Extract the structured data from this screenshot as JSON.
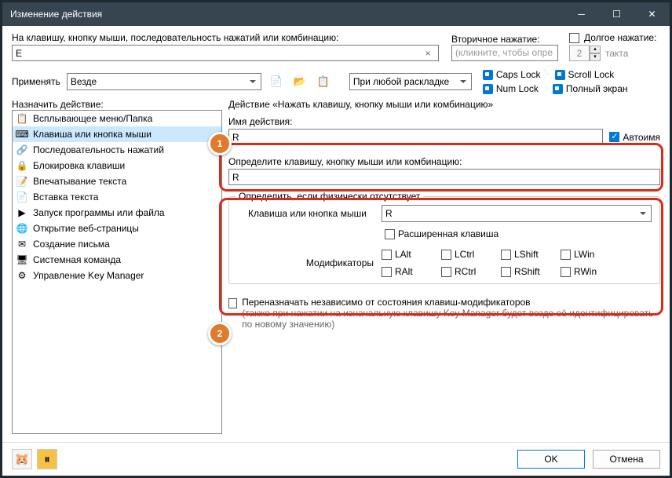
{
  "title": "Изменение действия",
  "labels": {
    "main_key": "На клавишу, кнопку мыши, последовательность нажатий или комбинацию:",
    "secondary": "Вторичное нажатие:",
    "long": "Долгое нажатие:",
    "apply": "Применять",
    "tact": "такта",
    "assign": "Назначить действие:"
  },
  "main_key_value": "E",
  "secondary_placeholder": "(кликните, чтобы опре",
  "long_value": "2",
  "apply_value": "Везде",
  "layout_value": "При любой раскладке",
  "toggles": {
    "caps": "Caps Lock",
    "scroll": "Scroll Lock",
    "num": "Num Lock",
    "full": "Полный экран"
  },
  "actions": [
    {
      "icon": "📋",
      "label": "Всплывающее меню/Папка"
    },
    {
      "icon": "⌨",
      "label": "Клавиша или кнопка мыши",
      "selected": true
    },
    {
      "icon": "🔗",
      "label": "Последовательность нажатий"
    },
    {
      "icon": "🔒",
      "label": "Блокировка клавиши"
    },
    {
      "icon": "📝",
      "label": "Впечатывание текста"
    },
    {
      "icon": "📄",
      "label": "Вставка текста"
    },
    {
      "icon": "▶",
      "label": "Запуск программы или файла"
    },
    {
      "icon": "🌐",
      "label": "Открытие веб-страницы"
    },
    {
      "icon": "✉",
      "label": "Создание письма"
    },
    {
      "icon": "🖥",
      "label": "Системная команда"
    },
    {
      "icon": "⚙",
      "label": "Управление Key Manager"
    }
  ],
  "panel": {
    "header": "Действие «Нажать клавишу, кнопку мыши или комбинацию»",
    "name_label": "Имя действия:",
    "name_value": "R",
    "autoname": "Автоимя",
    "define_label": "Определите клавишу, кнопку мыши или комбинацию:",
    "define_value": "R",
    "absent_title": "Определить, если физически отсутствует",
    "key_label": "Клавиша или кнопка мыши",
    "key_value": "R",
    "extended": "Расширенная клавиша",
    "mods_label": "Модификаторы",
    "mods1": [
      "LAlt",
      "LCtrl",
      "LShift",
      "LWin"
    ],
    "mods2": [
      "RAlt",
      "RCtrl",
      "RShift",
      "RWin"
    ],
    "reassign": "Переназначать независимо от состояния клавиш-модификаторов",
    "reassign_note": "(также при нажатии на изначальную клавишу Key Manager будет везде её идентифицировать по новому значению)"
  },
  "buttons": {
    "ok": "OK",
    "cancel": "Отмена"
  },
  "badges": {
    "b1": "1",
    "b2": "2"
  }
}
